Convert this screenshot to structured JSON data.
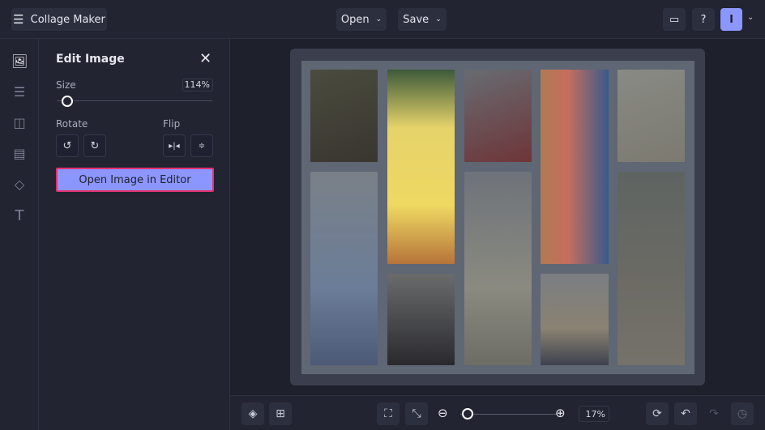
{
  "header": {
    "title": "Collage Maker",
    "open_label": "Open",
    "save_label": "Save",
    "avatar_initial": "I"
  },
  "panel": {
    "title": "Edit Image",
    "size_label": "Size",
    "size_value": "114%",
    "size_fraction": 0.05,
    "rotate_label": "Rotate",
    "flip_label": "Flip",
    "open_editor_label": "Open Image in Editor"
  },
  "bottom": {
    "zoom_value": "17%",
    "zoom_fraction": 0.05
  },
  "colors": {
    "accent": "#8c96ff",
    "highlight_border": "#e0336f",
    "avatar": "#8c96ff"
  }
}
